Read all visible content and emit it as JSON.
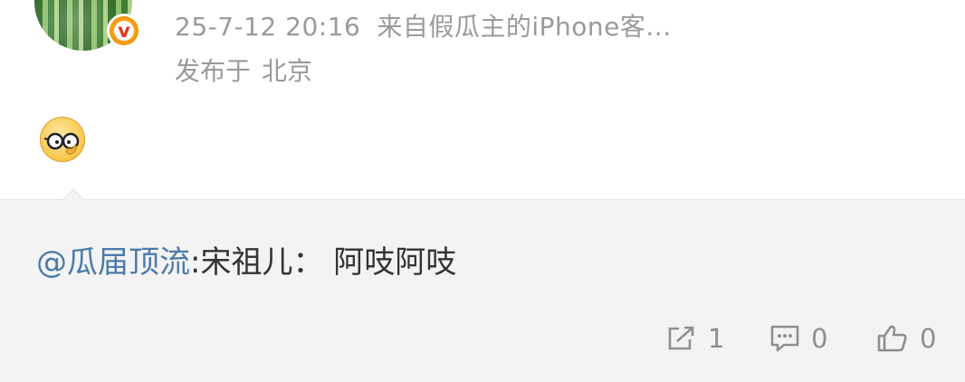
{
  "post": {
    "timestamp": "25-7-12 20:16",
    "source": "来自假瓜主的iPhone客...",
    "location_prefix": "发布于",
    "location_city": "北京",
    "emoji_icon": "glasses-face-icon"
  },
  "repost": {
    "mention": "@瓜届顶流",
    "text": ":宋祖儿：  阿吱阿吱"
  },
  "actions": {
    "share_count": "1",
    "comment_count": "0",
    "like_count": "0"
  },
  "colors": {
    "mention": "#4b7ba8",
    "meta": "#9a9a9a",
    "repost_bg": "#f3f3f3",
    "badge": "#f7a21b"
  }
}
